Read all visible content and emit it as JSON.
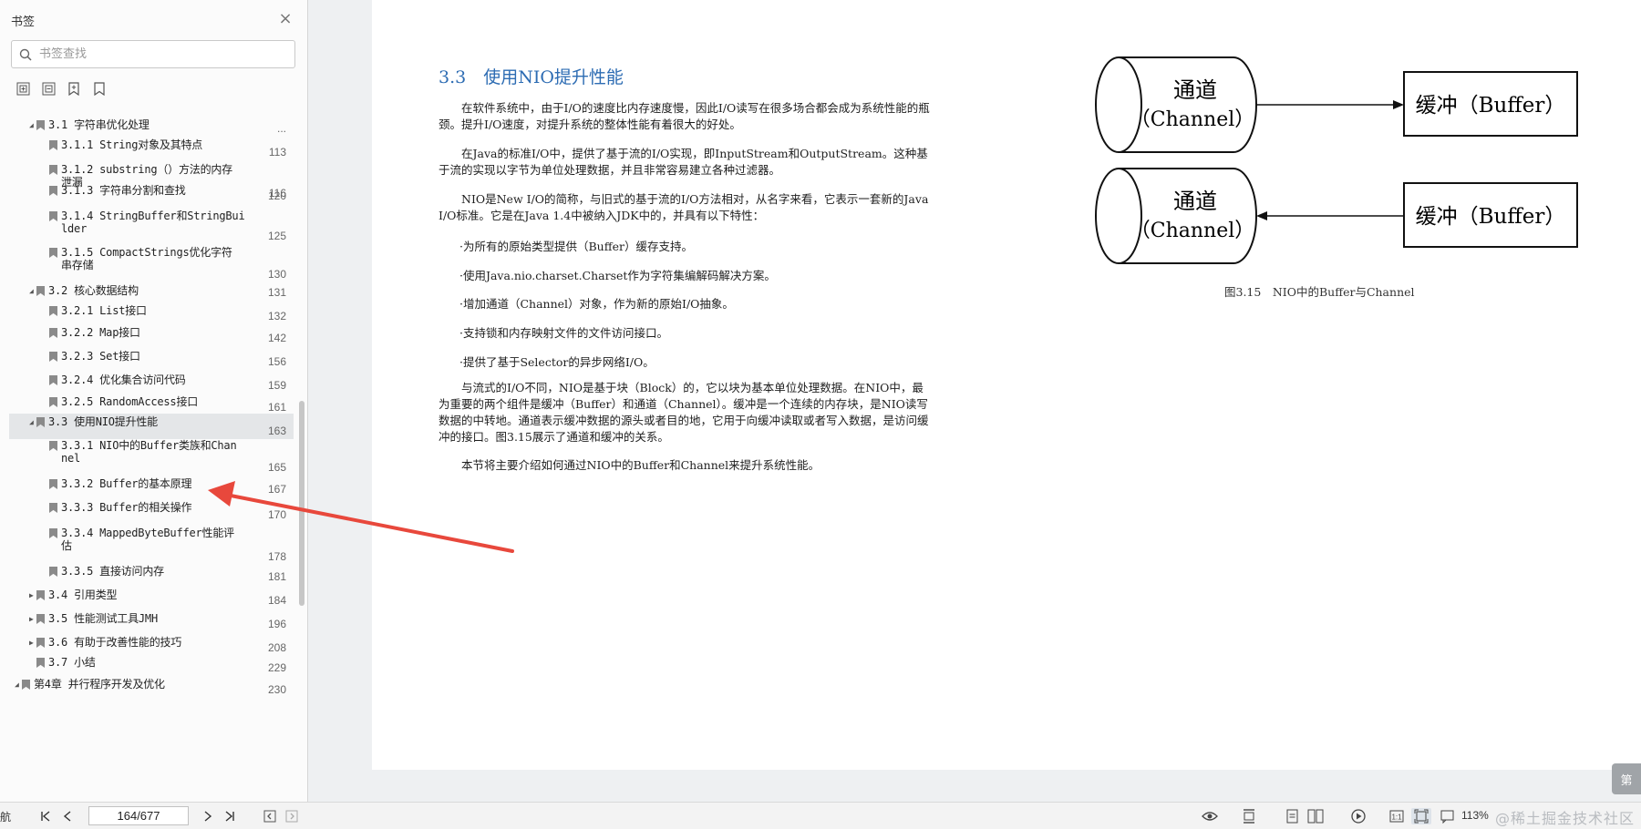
{
  "sidebar": {
    "title": "书签",
    "search_placeholder": "书签查找",
    "tools": [
      "expand-all-icon",
      "collapse-all-icon",
      "add-bookmark-icon",
      "bookmark-icon"
    ],
    "items": [
      {
        "label": "3.1 字符串优化处理",
        "page": "...",
        "level": 1,
        "expanded": true
      },
      {
        "label": "3.1.1 String对象及其特点",
        "page": "113",
        "level": 2
      },
      {
        "label": "3.1.2 substring（）方法的内存\n泄漏",
        "page": "116",
        "level": 2
      },
      {
        "label": "3.1.3 字符串分割和查找",
        "page": "120",
        "level": 2
      },
      {
        "label": "3.1.4 StringBuffer和StringBui\nlder",
        "page": "125",
        "level": 2
      },
      {
        "label": "3.1.5 CompactStrings优化字符\n串存储",
        "page": "130",
        "level": 2
      },
      {
        "label": "3.2 核心数据结构",
        "page": "131",
        "level": 1,
        "expanded": true
      },
      {
        "label": "3.2.1 List接口",
        "page": "132",
        "level": 2
      },
      {
        "label": "3.2.2 Map接口",
        "page": "142",
        "level": 2
      },
      {
        "label": "3.2.3 Set接口",
        "page": "156",
        "level": 2
      },
      {
        "label": "3.2.4 优化集合访问代码",
        "page": "159",
        "level": 2
      },
      {
        "label": "3.2.5 RandomAccess接口",
        "page": "161",
        "level": 2
      },
      {
        "label": "3.3 使用NIO提升性能",
        "page": "163",
        "level": 1,
        "expanded": true,
        "selected": true
      },
      {
        "label": "3.3.1 NIO中的Buffer类族和Chan\nnel",
        "page": "165",
        "level": 2
      },
      {
        "label": "3.3.2 Buffer的基本原理",
        "page": "167",
        "level": 2
      },
      {
        "label": "3.3.3 Buffer的相关操作",
        "page": "170",
        "level": 2
      },
      {
        "label": "3.3.4 MappedByteBuffer性能评\n估",
        "page": "178",
        "level": 2
      },
      {
        "label": "3.3.5 直接访问内存",
        "page": "181",
        "level": 2
      },
      {
        "label": "3.4 引用类型",
        "page": "184",
        "level": 1,
        "expanded": false
      },
      {
        "label": "3.5 性能测试工具JMH",
        "page": "196",
        "level": 1,
        "expanded": false
      },
      {
        "label": "3.6 有助于改善性能的技巧",
        "page": "208",
        "level": 1,
        "expanded": false
      },
      {
        "label": "3.7 小结",
        "page": "229",
        "level": 1
      },
      {
        "label": "第4章 并行程序开发及优化",
        "page": "230",
        "level": 0,
        "expanded": true
      }
    ]
  },
  "document": {
    "section_title": "3.3　使用NIO提升性能",
    "paragraphs": [
      "在软件系统中，由于I/O的速度比内存速度慢，因此I/O读写在很多场合都会成为系统性能的瓶颈。提升I/O速度，对提升系统的整体性能有着很大的好处。",
      "在Java的标准I/O中，提供了基于流的I/O实现，即InputStream和OutputStream。这种基于流的实现以字节为单位处理数据，并且非常容易建立各种过滤器。",
      "NIO是New I/O的简称，与旧式的基于流的I/O方法相对，从名字来看，它表示一套新的Java I/O标准。它是在Java 1.4中被纳入JDK中的，并具有以下特性："
    ],
    "bullets": [
      "·为所有的原始类型提供（Buffer）缓存支持。",
      "·使用Java.nio.charset.Charset作为字符集编解码解决方案。",
      "·增加通道（Channel）对象，作为新的原始I/O抽象。",
      "·支持锁和内存映射文件的文件访问接口。",
      "·提供了基于Selector的异步网络I/O。"
    ],
    "paragraph4": "与流式的I/O不同，NIO是基于块（Block）的，它以块为基本单位处理数据。在NIO中，最为重要的两个组件是缓冲（Buffer）和通道（Channel）。缓冲是一个连续的内存块，是NIO读写数据的中转地。通道表示缓冲数据的源头或者目的地，它用于向缓冲读取或者写入数据，是访问缓冲的接口。图3.15展示了通道和缓冲的关系。",
    "paragraph5": "本节将主要介绍如何通过NIO中的Buffer和Channel来提升系统性能。",
    "figure": {
      "channel_line1": "通道",
      "channel_line2": "（Channel）",
      "buffer_label": "缓冲（Buffer）",
      "caption": "图3.15　NIO中的Buffer与Channel"
    },
    "side_tab": "第"
  },
  "bottombar": {
    "nav_label": "航",
    "page_value": "164/677",
    "zoom": "113%",
    "watermark": "@稀土掘金技术社区",
    "icons": [
      "first-page-icon",
      "prev-page-icon",
      "next-page-icon",
      "last-page-icon",
      "back-icon",
      "forward-icon",
      "eye-icon",
      "fit-width-icon",
      "single-page-icon",
      "two-page-icon",
      "play-icon",
      "actual-size-icon",
      "fit-page-icon",
      "bookmark-view-icon"
    ]
  },
  "colors": {
    "heading_blue": "#2d6cb3",
    "arrow_red": "#e8483c",
    "selected_row": "#e4e6e8"
  }
}
